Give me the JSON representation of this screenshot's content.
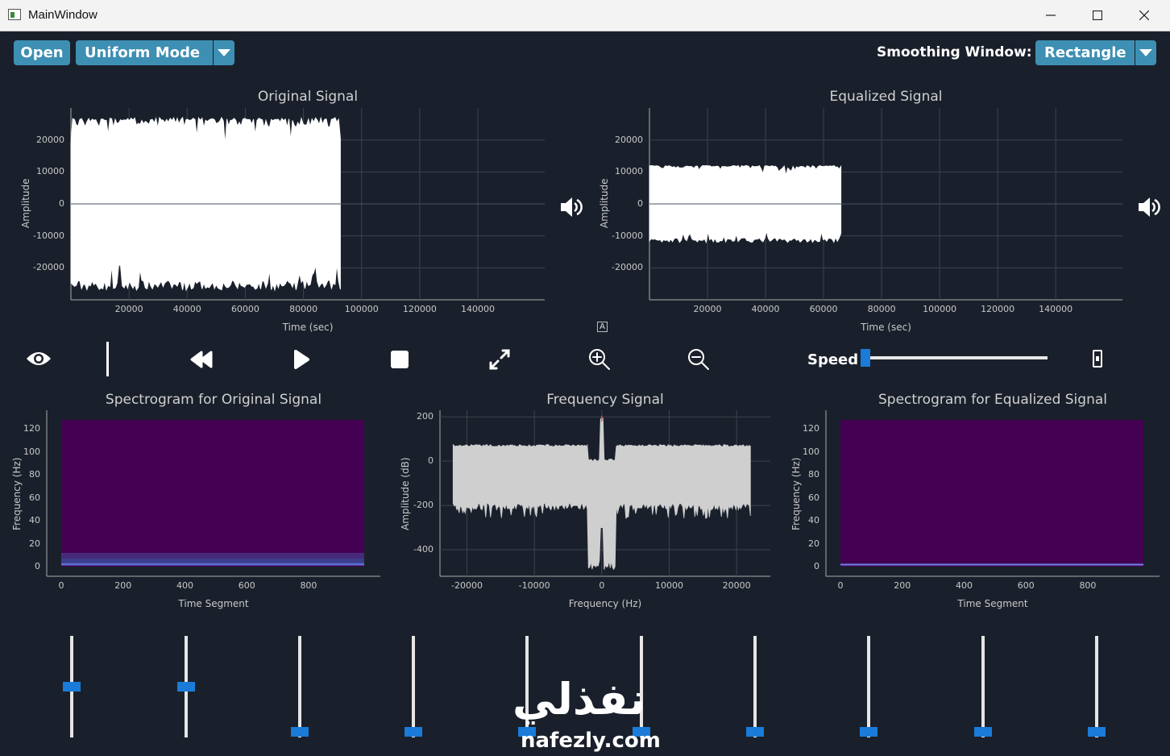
{
  "window": {
    "title": "MainWindow"
  },
  "toolbar": {
    "open_label": "Open",
    "mode_value": "Uniform Mode",
    "smoothing_label": "Smoothing Window:",
    "smoothing_value": "Rectangle"
  },
  "plots": {
    "original": {
      "title": "Original Signal",
      "xlabel": "Time (sec)",
      "ylabel": "Amplitude",
      "xticks": [
        "20000",
        "40000",
        "60000",
        "80000",
        "100000",
        "120000",
        "140000"
      ],
      "yticks": [
        "20000",
        "10000",
        "0",
        "-10000",
        "-20000"
      ]
    },
    "equalized": {
      "title": "Equalized Signal",
      "xlabel": "Time (sec)",
      "ylabel": "Amplitude",
      "xticks": [
        "20000",
        "40000",
        "60000",
        "80000",
        "100000",
        "120000",
        "140000"
      ],
      "yticks": [
        "20000",
        "10000",
        "0",
        "-10000",
        "-20000"
      ]
    },
    "spec_original": {
      "title": "Spectrogram for Original Signal",
      "xlabel": "Time Segment",
      "ylabel": "Frequency (Hz)",
      "xticks": [
        "0",
        "200",
        "400",
        "600",
        "800"
      ],
      "yticks": [
        "120",
        "100",
        "80",
        "60",
        "40",
        "20",
        "0"
      ]
    },
    "frequency": {
      "title": "Frequency Signal",
      "xlabel": "Frequency (Hz)",
      "ylabel": "Amplitude (dB)",
      "xticks": [
        "-20000",
        "-10000",
        "0",
        "10000",
        "20000"
      ],
      "yticks": [
        "200",
        "0",
        "-200",
        "-400"
      ]
    },
    "spec_equalized": {
      "title": "Spectrogram for Equalized Signal",
      "xlabel": "Time Segment",
      "ylabel": "Frequency (Hz)",
      "xticks": [
        "0",
        "200",
        "400",
        "600",
        "800"
      ],
      "yticks": [
        "120",
        "100",
        "80",
        "60",
        "40",
        "20",
        "0"
      ]
    }
  },
  "controls": {
    "speed_label": "Speed",
    "speed_value": 0.0,
    "autoscale_glyph": "A"
  },
  "equalizer": {
    "slider_levels": [
      0.5,
      0.5,
      0,
      0,
      0,
      0,
      0,
      0,
      0,
      0
    ]
  },
  "watermark": {
    "arabic": "نفذلي",
    "latin": "nafezly.com"
  },
  "chart_data": [
    {
      "type": "line",
      "title": "Original Signal",
      "xlabel": "Time (sec)",
      "ylabel": "Amplitude",
      "xlim": [
        0,
        163000
      ],
      "ylim": [
        -30000,
        30000
      ],
      "x_extent": [
        0,
        93000
      ],
      "envelope": [
        -27000,
        27000
      ]
    },
    {
      "type": "line",
      "title": "Equalized Signal",
      "xlabel": "Time (sec)",
      "ylabel": "Amplitude",
      "xlim": [
        0,
        163000
      ],
      "ylim": [
        -30000,
        30000
      ],
      "x_extent": [
        0,
        66000
      ],
      "envelope": [
        -12000,
        12000
      ]
    },
    {
      "type": "heatmap",
      "title": "Spectrogram for Original Signal",
      "xlabel": "Time Segment",
      "ylabel": "Frequency (Hz)",
      "xlim": [
        0,
        980
      ],
      "ylim": [
        0,
        128
      ]
    },
    {
      "type": "line",
      "title": "Frequency Signal",
      "xlabel": "Frequency (Hz)",
      "ylabel": "Amplitude (dB)",
      "xlim": [
        -24000,
        25000
      ],
      "ylim": [
        -520,
        230
      ],
      "x_extent": [
        -22050,
        22050
      ]
    },
    {
      "type": "heatmap",
      "title": "Spectrogram for Equalized Signal",
      "xlabel": "Time Segment",
      "ylabel": "Frequency (Hz)",
      "xlim": [
        0,
        980
      ],
      "ylim": [
        0,
        128
      ]
    }
  ]
}
